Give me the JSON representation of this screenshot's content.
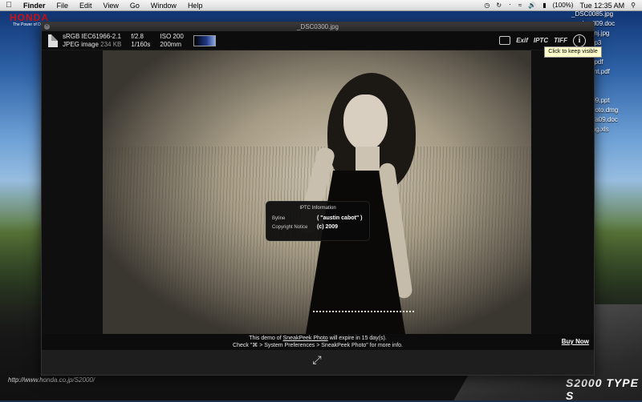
{
  "menubar": {
    "apple": "",
    "items": [
      "Finder",
      "File",
      "Edit",
      "View",
      "Go",
      "Window",
      "Help"
    ],
    "battery": "(100%)",
    "clock": "Tue 12:35 AM"
  },
  "desktop": {
    "brand": "HONDA",
    "brand_tag": "The Power of Dreams",
    "footer_url": "http://www.honda.co.jp/S2000/",
    "car_logo": "S2000 TYPE S",
    "items": [
      "_DSC0085.jpg",
      "...ud...all09.doc",
      "...=_all_nj.jpg",
      "...arvi.mp3",
      "...j.torrent",
      "...eever.pdf",
      "...y...ment.pdf",
      "...ktop",
      "...",
      "...w...fa09.ppt",
      "...eekPhoto.dmg",
      "...5501-fa09.doc",
      "...gpricing.xls"
    ]
  },
  "viewer": {
    "title": "_DSC0300.jpg",
    "color_profile": "sRGB IEC61966-2.1",
    "file_type": "JPEG image",
    "file_size": "234 KB",
    "aperture": "f/2.8",
    "shutter": "1/160s",
    "iso": "ISO 200",
    "focal": "200mm",
    "toolbar": {
      "exif": "Exif",
      "iptc": "IPTC",
      "tiff": "TIFF"
    },
    "tooltip": "Click to keep visible",
    "iptc_panel": {
      "title": "IPTC Information",
      "byline_label": "Byline",
      "byline_value": "( \"austin cabot\" )",
      "copyright_label": "Copyright Notice",
      "copyright_value": "(c) 2009"
    },
    "demo": {
      "line1_prefix": "This demo of ",
      "line1_link": "SneakPeek Photo",
      "line1_suffix": " will expire in 15 day(s).",
      "line2": "Check \"⌘ > System Preferences > SneakPeek Photo\" for more info."
    },
    "buy_now": "Buy Now"
  }
}
